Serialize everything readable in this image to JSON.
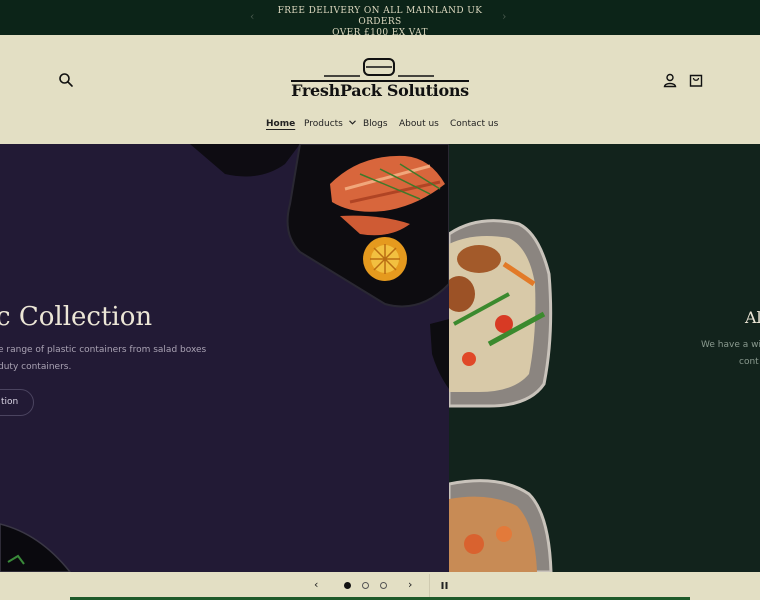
{
  "announcement": {
    "line1": "FREE DELIVERY ON ALL MAINLAND UK ORDERS",
    "line2": "OVER £100 EX VAT",
    "prev_icon": "chevron-left-icon",
    "next_icon": "chevron-right-icon"
  },
  "header": {
    "logo_text": "FreshPack Solutions",
    "search_icon": "search-icon",
    "account_icon": "user-icon",
    "cart_icon": "cart-icon",
    "nav": [
      {
        "label": "Home"
      },
      {
        "label": "Products"
      },
      {
        "label": "Blogs"
      },
      {
        "label": "About us"
      },
      {
        "label": "Contact us"
      }
    ]
  },
  "hero": {
    "slide1": {
      "title": "c Collection",
      "desc_line1": "e range of plastic containers from salad boxes",
      "desc_line2": "duty containers.",
      "button": "tion"
    },
    "slide2": {
      "title": "Al",
      "desc_line1": "We have a wi",
      "desc_line2": "cont"
    }
  },
  "slider": {
    "prev_icon": "chevron-left-icon",
    "next_icon": "chevron-right-icon",
    "pause_icon": "pause-icon",
    "total_slides": 3,
    "active_slide": 1
  },
  "colors": {
    "announcement_bg": "#0c2418",
    "header_bg": "#e3dfc4",
    "slide1_bg": "#221a35",
    "slide2_bg": "#12231c"
  }
}
